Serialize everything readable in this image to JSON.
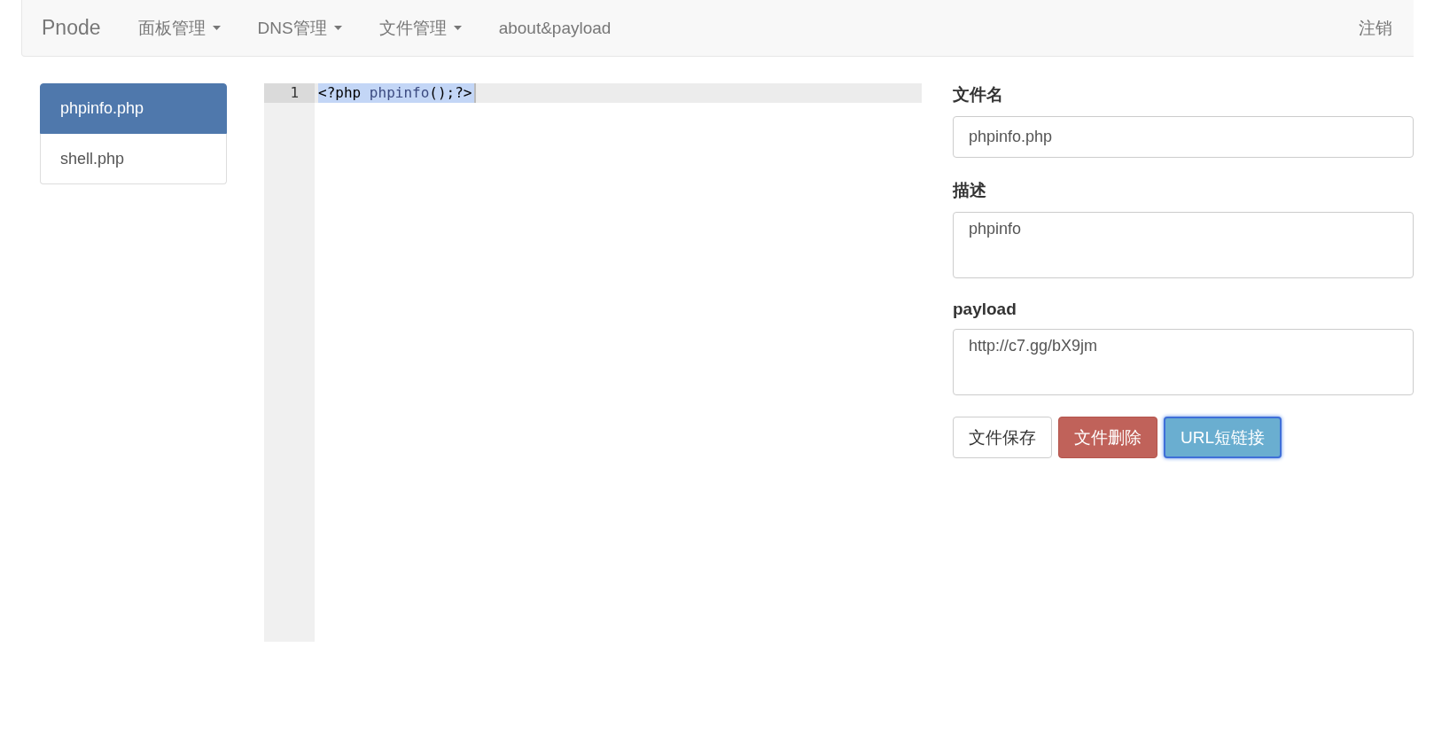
{
  "navbar": {
    "brand": "Pnode",
    "items": [
      {
        "label": "面板管理",
        "kind": "dropdown"
      },
      {
        "label": "DNS管理",
        "kind": "dropdown"
      },
      {
        "label": "文件管理",
        "kind": "dropdown"
      },
      {
        "label": "about&payload",
        "kind": "link"
      }
    ],
    "right_link": "注销"
  },
  "file_list": [
    {
      "name": "phpinfo.php",
      "selected": true
    },
    {
      "name": "shell.php",
      "selected": false
    }
  ],
  "editor": {
    "lines": [
      {
        "number": "1",
        "selected": true,
        "tokens": [
          {
            "text": "<?php ",
            "kind": "plain"
          },
          {
            "text": "phpinfo",
            "kind": "function"
          },
          {
            "text": "();?>",
            "kind": "plain"
          }
        ]
      }
    ]
  },
  "form": {
    "fields": [
      {
        "label": "文件名",
        "kind": "input",
        "value": "phpinfo.php"
      },
      {
        "label": "描述",
        "kind": "textarea",
        "value": "phpinfo"
      },
      {
        "label": "payload",
        "kind": "textarea",
        "value": "http://c7.gg/bX9jm"
      }
    ],
    "buttons": [
      {
        "label": "文件保存",
        "kind": "default",
        "focused": false
      },
      {
        "label": "文件删除",
        "kind": "danger",
        "focused": false
      },
      {
        "label": "URL短链接",
        "kind": "info",
        "focused": true
      }
    ]
  }
}
